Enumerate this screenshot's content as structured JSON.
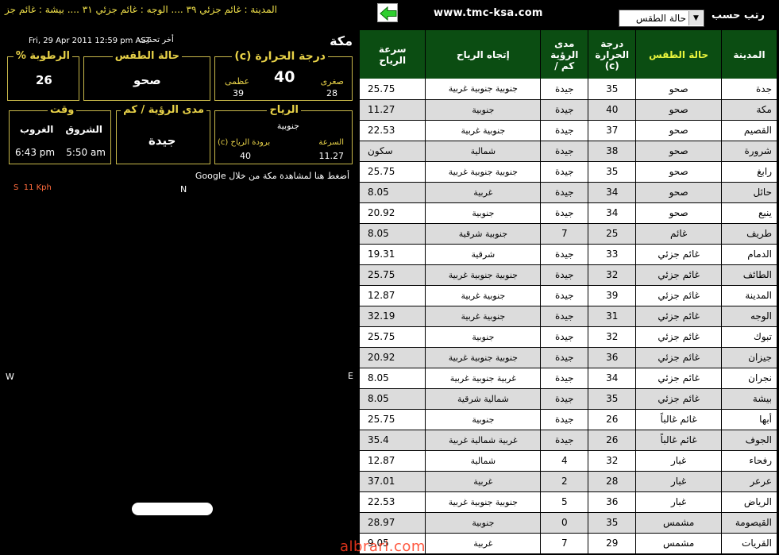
{
  "header": {
    "ticker": "المدينة : غائم جزئي ٣٩  ....  الوجه : غائم جزئي ٣١  ....  بيشة : غائم جز",
    "site_url": "www.tmc-ksa.com",
    "sort_label": "رتب حسب",
    "sort_selected": "حالة الطقس",
    "back_icon": "green-arrow-left-icon"
  },
  "current": {
    "city": "مكة",
    "updated_label": "أخر تحديث",
    "updated_value": "Fri, 29 Apr 2011 12:59 pm AST",
    "temperature": {
      "title": "(c) درجة الحرارة",
      "value": "40",
      "min_label": "صغرى",
      "min_value": "28",
      "max_label": "عظمى",
      "max_value": "39"
    },
    "weather": {
      "title": "حالة الطقس",
      "value": "صحو"
    },
    "humidity": {
      "title": "% الرطوبة",
      "value": "26"
    },
    "wind": {
      "title": "الرياح",
      "direction": "جنوبية",
      "speed_label": "السرعة",
      "speed_value": "11.27",
      "chill_label": "(c) برودة  الرياح",
      "chill_value": "40"
    },
    "visibility": {
      "title": "مدى الرؤية / كم",
      "value": "جيدة"
    },
    "time": {
      "title": "وقت",
      "sunrise_label": "الشروق",
      "sunrise_value": "5:50 am",
      "sunset_label": "الغروب",
      "sunset_value": "6:43 pm"
    },
    "google_link": "أضغط هنا لمشاهدة مكة من خلال Google",
    "radar": {
      "n": "N",
      "s": "S",
      "e": "E",
      "w": "W",
      "speed_indicator": "11 Kph"
    }
  },
  "table": {
    "headers": {
      "city": "المدينة",
      "weather": "حالة الطقس",
      "temp": "درجة الحرارة (c)",
      "visibility": "مدى الرؤية كم /",
      "direction": "إتجاه الرياح",
      "speed": "سرعة الرياح"
    },
    "rows": [
      {
        "city": "جدة",
        "wx": "صحو",
        "temp": "35",
        "vis": "جيدة",
        "dir": "جنوبية جنوبية غربية",
        "spd": "25.75"
      },
      {
        "city": "مكة",
        "wx": "صحو",
        "temp": "40",
        "vis": "جيدة",
        "dir": "جنوبية",
        "spd": "11.27"
      },
      {
        "city": "القصيم",
        "wx": "صحو",
        "temp": "37",
        "vis": "جيدة",
        "dir": "جنوبية غربية",
        "spd": "22.53"
      },
      {
        "city": "شرورة",
        "wx": "صحو",
        "temp": "38",
        "vis": "جيدة",
        "dir": "شمالية",
        "spd": "سكون"
      },
      {
        "city": "رابغ",
        "wx": "صحو",
        "temp": "35",
        "vis": "جيدة",
        "dir": "جنوبية جنوبية غربية",
        "spd": "25.75"
      },
      {
        "city": "حائل",
        "wx": "صحو",
        "temp": "34",
        "vis": "جيدة",
        "dir": "غربية",
        "spd": "8.05"
      },
      {
        "city": "ينبع",
        "wx": "صحو",
        "temp": "34",
        "vis": "جيدة",
        "dir": "جنوبية",
        "spd": "20.92"
      },
      {
        "city": "طريف",
        "wx": "غائم",
        "temp": "25",
        "vis": "7",
        "dir": "جنوبية شرقية",
        "spd": "8.05"
      },
      {
        "city": "الدمام",
        "wx": "غائم جزئي",
        "temp": "33",
        "vis": "جيدة",
        "dir": "شرقية",
        "spd": "19.31"
      },
      {
        "city": "الطائف",
        "wx": "غائم جزئي",
        "temp": "32",
        "vis": "جيدة",
        "dir": "جنوبية جنوبية غربية",
        "spd": "25.75"
      },
      {
        "city": "المدينة",
        "wx": "غائم جزئي",
        "temp": "39",
        "vis": "جيدة",
        "dir": "جنوبية غربية",
        "spd": "12.87"
      },
      {
        "city": "الوجه",
        "wx": "غائم جزئي",
        "temp": "31",
        "vis": "جيدة",
        "dir": "جنوبية غربية",
        "spd": "32.19"
      },
      {
        "city": "تبوك",
        "wx": "غائم جزئي",
        "temp": "32",
        "vis": "جيدة",
        "dir": "جنوبية",
        "spd": "25.75"
      },
      {
        "city": "جيزان",
        "wx": "غائم جزئي",
        "temp": "36",
        "vis": "جيدة",
        "dir": "جنوبية جنوبية غربية",
        "spd": "20.92"
      },
      {
        "city": "نجران",
        "wx": "غائم جزئي",
        "temp": "34",
        "vis": "جيدة",
        "dir": "غربية جنوبية غربية",
        "spd": "8.05"
      },
      {
        "city": "بيشة",
        "wx": "غائم جزئي",
        "temp": "35",
        "vis": "جيدة",
        "dir": "شمالية شرقية",
        "spd": "8.05"
      },
      {
        "city": "أبها",
        "wx": "غائم غالباً",
        "temp": "26",
        "vis": "جيدة",
        "dir": "جنوبية",
        "spd": "25.75"
      },
      {
        "city": "الجوف",
        "wx": "غائم غالباً",
        "temp": "26",
        "vis": "جيدة",
        "dir": "غربية شمالية غربية",
        "spd": "35.4"
      },
      {
        "city": "رفحاء",
        "wx": "غبار",
        "temp": "32",
        "vis": "4",
        "dir": "شمالية",
        "spd": "12.87"
      },
      {
        "city": "عرعر",
        "wx": "غبار",
        "temp": "28",
        "vis": "2",
        "dir": "غربية",
        "spd": "37.01"
      },
      {
        "city": "الرياض",
        "wx": "غبار",
        "temp": "36",
        "vis": "5",
        "dir": "جنوبية جنوبية غربية",
        "spd": "22.53"
      },
      {
        "city": "القيصومة",
        "wx": "مشمس",
        "temp": "35",
        "vis": "0",
        "dir": "جنوبية",
        "spd": "28.97"
      },
      {
        "city": "القريات",
        "wx": "مشمس",
        "temp": "29",
        "vis": "7",
        "dir": "غربية",
        "spd": "9.05"
      }
    ]
  },
  "watermark": "albrari.com"
}
